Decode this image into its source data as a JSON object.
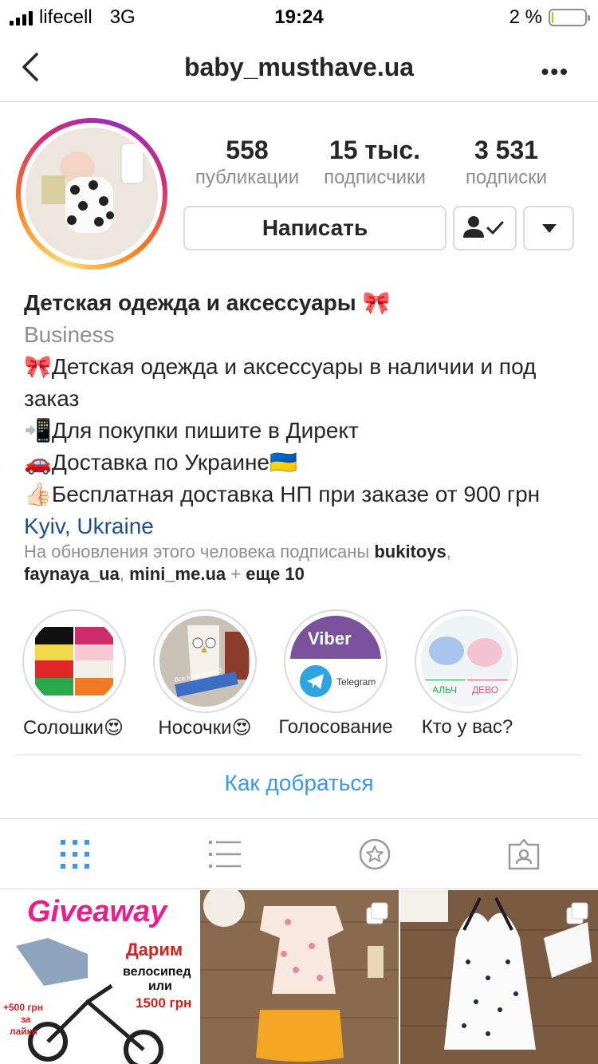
{
  "status": {
    "carrier": "lifecell",
    "network": "3G",
    "time": "19:24",
    "battery": "2 %",
    "battery_level": 0.02
  },
  "nav": {
    "title": "baby_musthave.ua",
    "more": "•••"
  },
  "stats": [
    {
      "value": "558",
      "label": "публикации"
    },
    {
      "value": "15 тыс.",
      "label": "подписчики"
    },
    {
      "value": "3 531",
      "label": "подписки"
    }
  ],
  "buttons": {
    "message": "Написать"
  },
  "bio": {
    "name": "Детская одежда и аксессуары 🎀",
    "category": "Business",
    "lines": [
      "🎀Детская одежда и аксессуары в наличии и под заказ",
      "📲Для покупки пишите в Директ",
      "🚗Доставка по Украине🇺🇦",
      "👍🏻Бесплатная доставка НП при заказе от 900 грн"
    ],
    "location": "Kyiv, Ukraine"
  },
  "followed_by": {
    "prefix": "На обновления этого человека подписаны",
    "user1": "bukitoys",
    "user2": "faynaya_ua",
    "user3": "mini_me.ua",
    "plus": "+",
    "more": "еще 10"
  },
  "highlights": [
    {
      "label": "Солошки😍"
    },
    {
      "label": "Носочки😍"
    },
    {
      "label": "Голосование",
      "badge1": "Viber",
      "badge2": "Telegram"
    },
    {
      "label": "Кто у вас?",
      "text1": "АЛЬЧ",
      "text2": "ДЕВО"
    }
  ],
  "sock_tag": "Все в наличии😍",
  "directions": "Как добраться",
  "posts": [
    {
      "title": "Giveaway",
      "line1": "Дарим",
      "line2": "велосипед",
      "line3": "или",
      "line4": "1500 грн",
      "bonus1": "+500 грн",
      "bonus2": "за",
      "bonus3": "лайки"
    },
    {},
    {}
  ],
  "colors": {
    "accent": "#3897f0",
    "link": "#1f4e8c",
    "muted": "#8e8e8e",
    "border": "#dbdbdb"
  }
}
